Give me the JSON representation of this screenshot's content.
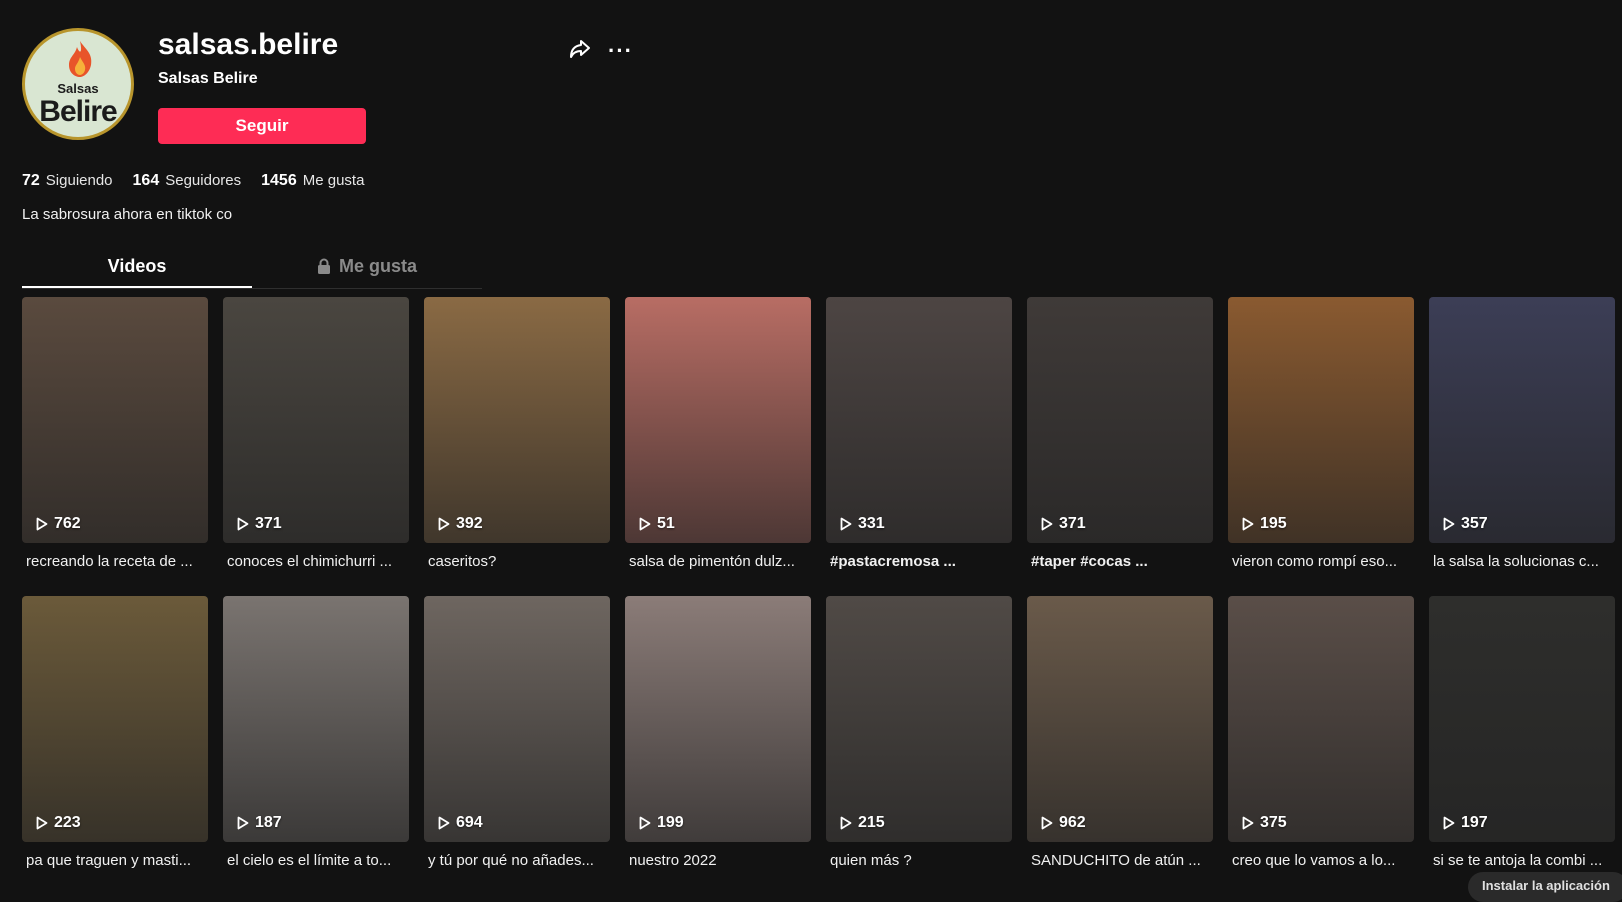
{
  "profile": {
    "username": "salsas.belire",
    "nickname": "Salsas Belire",
    "avatar_text_top": "Salsas",
    "avatar_text_bottom": "Belire",
    "follow_label": "Seguir",
    "stats": [
      {
        "value": "72",
        "label": "Siguiendo"
      },
      {
        "value": "164",
        "label": "Seguidores"
      },
      {
        "value": "1456",
        "label": "Me gusta"
      }
    ],
    "bio": "La sabrosura ahora en tiktok co"
  },
  "tabs": {
    "videos": "Videos",
    "likes": "Me gusta"
  },
  "videos": [
    {
      "views": "762",
      "caption": "recreando la receta de ...",
      "bg": "#5a4a3e"
    },
    {
      "views": "371",
      "caption": "conoces el chimichurri ...",
      "bg": "#4a4640"
    },
    {
      "views": "392",
      "caption": "caseritos?",
      "bg": "#8a6a44"
    },
    {
      "views": "51",
      "caption": "salsa de pimentón dulz...",
      "bg": "#b86d64"
    },
    {
      "views": "331",
      "caption": "#pastacremosa ...",
      "bg": "#4d4543"
    },
    {
      "views": "371",
      "caption": "#taper #cocas ...",
      "bg": "#3f3a38"
    },
    {
      "views": "195",
      "caption": "vieron como rompí eso...",
      "bg": "#8a5a30"
    },
    {
      "views": "357",
      "caption": "la salsa la solucionas c...",
      "bg": "#3c3e56"
    },
    {
      "views": "223",
      "caption": "pa que traguen y masti...",
      "bg": "#6b5a3a"
    },
    {
      "views": "187",
      "caption": "el cielo es el límite a to...",
      "bg": "#7a7470"
    },
    {
      "views": "694",
      "caption": "y tú por qué no añades...",
      "bg": "#6e6660"
    },
    {
      "views": "199",
      "caption": "nuestro 2022",
      "bg": "#8b7c78"
    },
    {
      "views": "215",
      "caption": "quien más ?",
      "bg": "#504a46"
    },
    {
      "views": "962",
      "caption": "SANDUCHITO de atún ...",
      "bg": "#6a5a4a"
    },
    {
      "views": "375",
      "caption": "creo que lo vamos a lo...",
      "bg": "#5a4e48"
    },
    {
      "views": "197",
      "caption": "si se te antoja la combi ...",
      "bg": "#2e2e2c"
    }
  ],
  "install_label": "Instalar la aplicación"
}
